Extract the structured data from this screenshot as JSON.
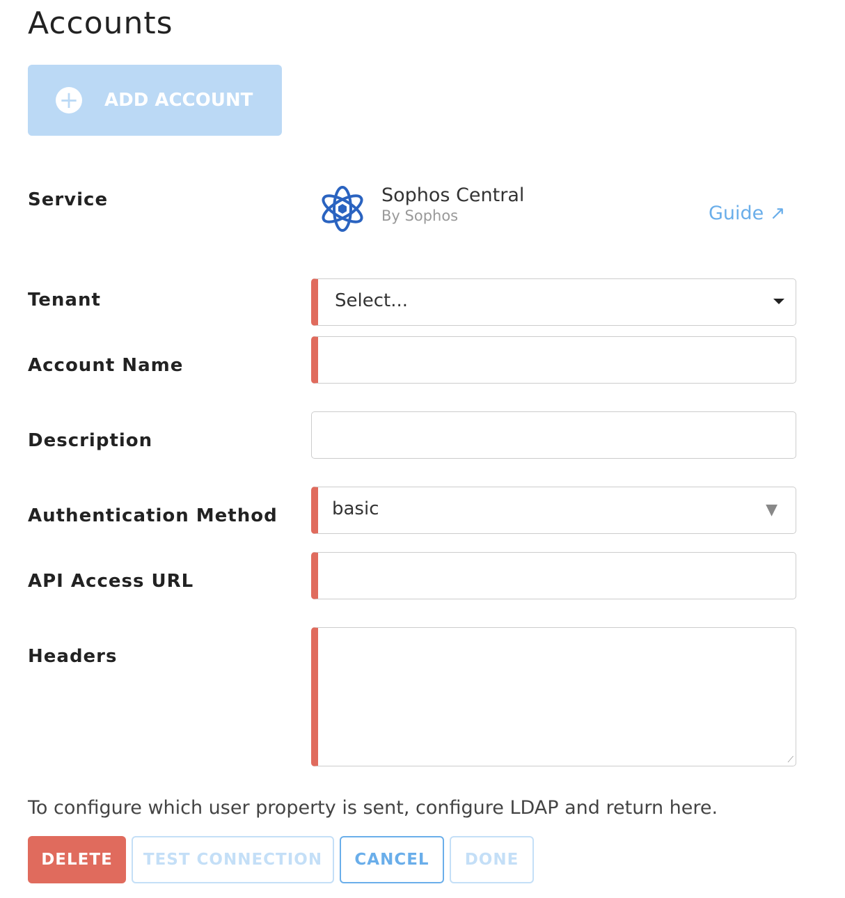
{
  "page": {
    "title": "Accounts",
    "add_account": "ADD ACCOUNT"
  },
  "form": {
    "service_label": "Service",
    "service_name": "Sophos Central",
    "service_vendor": "By Sophos",
    "guide": "Guide",
    "tenant_label": "Tenant",
    "tenant_value": "Select...",
    "account_name_label": "Account Name",
    "description_label": "Description",
    "auth_label": "Authentication Method",
    "auth_value": "basic",
    "api_label": "API Access URL",
    "headers_label": "Headers",
    "note": "To configure which user property is sent, configure LDAP and return here."
  },
  "buttons": {
    "delete": "DELETE",
    "test": "TEST CONNECTION",
    "cancel": "CANCEL",
    "done": "DONE"
  },
  "colors": {
    "required": "#e06b5d",
    "accent": "#6aaeea",
    "delete": "#e06b5d"
  }
}
